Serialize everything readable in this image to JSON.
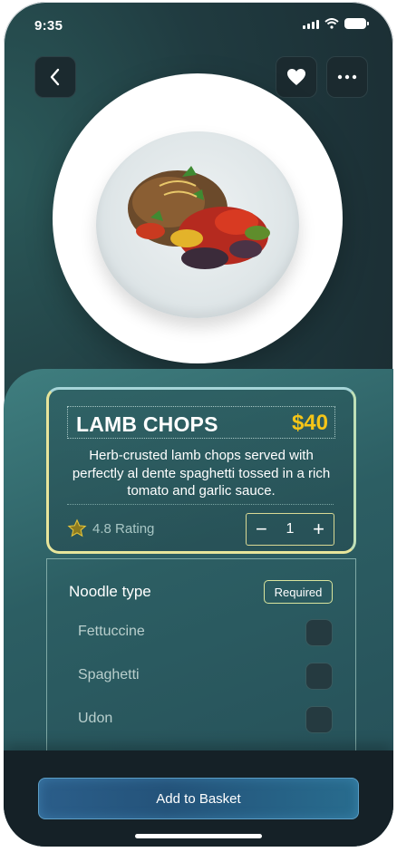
{
  "status_bar": {
    "time": "9:35"
  },
  "header": {
    "back_icon": "chevron-left-icon",
    "favorite_icon": "heart-icon",
    "more_icon": "ellipsis-icon"
  },
  "product": {
    "name": "LAMB CHOPS",
    "price": "$40",
    "description": "Herb-crusted lamb chops served with perfectly al dente spaghetti tossed in a rich tomato and garlic sauce.",
    "rating_text": "4.8 Rating",
    "quantity": "1"
  },
  "options": {
    "title": "Noodle type",
    "required_label": "Required",
    "items": [
      {
        "label": "Fettuccine"
      },
      {
        "label": "Spaghetti"
      },
      {
        "label": "Udon"
      }
    ]
  },
  "footer": {
    "add_button_label": "Add to Basket"
  },
  "colors": {
    "accent_price": "#f5c518",
    "button_blue": "#2b5e8a",
    "panel_teal": "#3f7e7f"
  }
}
